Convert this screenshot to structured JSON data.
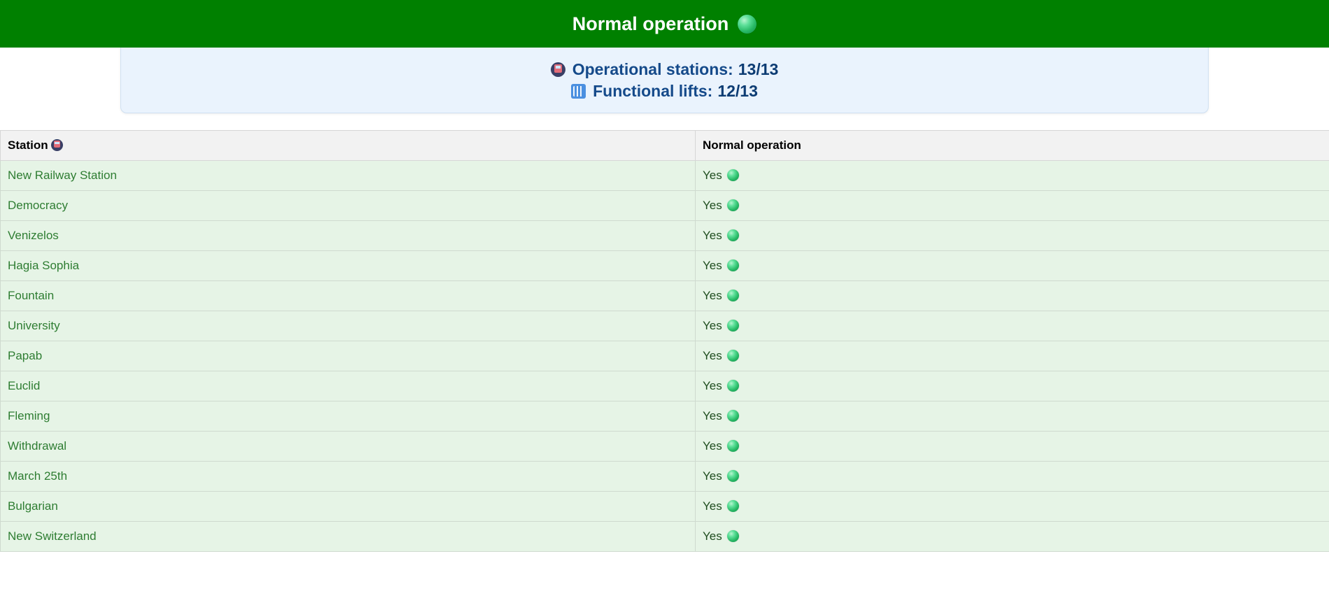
{
  "banner": {
    "title": "Normal operation",
    "status_icon": "green-circle-icon",
    "background": "#008000"
  },
  "summary": {
    "stations_label": "Operational stations:",
    "stations_value": "13/13",
    "stations_icon": "metro-icon",
    "lifts_label": "Functional lifts:",
    "lifts_value": "12/13",
    "lifts_icon": "elevator-icon"
  },
  "table": {
    "columns": [
      "Station",
      "Normal operation"
    ],
    "station_header_icon": "metro-icon",
    "rows": [
      {
        "station": "New Railway Station",
        "status": "Yes"
      },
      {
        "station": "Democracy",
        "status": "Yes"
      },
      {
        "station": "Venizelos",
        "status": "Yes"
      },
      {
        "station": "Hagia Sophia",
        "status": "Yes"
      },
      {
        "station": "Fountain",
        "status": "Yes"
      },
      {
        "station": "University",
        "status": "Yes"
      },
      {
        "station": "Papab",
        "status": "Yes"
      },
      {
        "station": "Euclid",
        "status": "Yes"
      },
      {
        "station": "Fleming",
        "status": "Yes"
      },
      {
        "station": "Withdrawal",
        "status": "Yes"
      },
      {
        "station": "March 25th",
        "status": "Yes"
      },
      {
        "station": "Bulgarian",
        "status": "Yes"
      },
      {
        "station": "New Switzerland",
        "status": "Yes"
      }
    ]
  }
}
